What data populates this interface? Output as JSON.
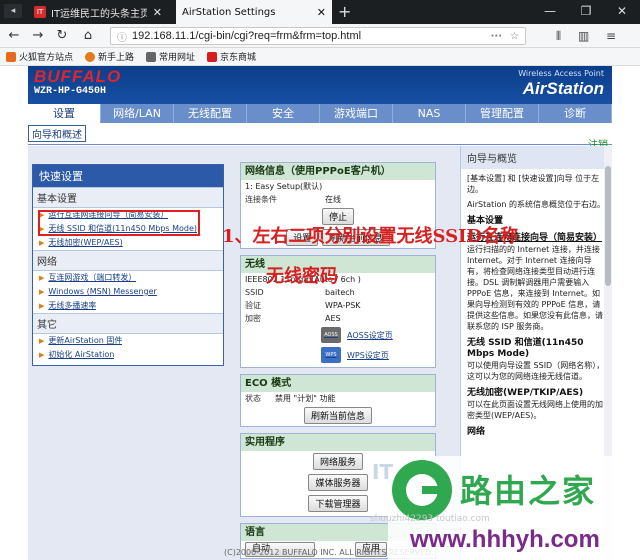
{
  "browser": {
    "tabs": [
      {
        "label": "IT运维民工的头条主页 - 今日头",
        "favicon_text": "IT"
      },
      {
        "label": "AirStation Settings"
      }
    ],
    "url": "192.168.11.1/cgi-bin/cgi?req=frm&frm=top.html",
    "bookmarks": [
      "火狐官方站点",
      "新手上路",
      "常用网址",
      "京东商城"
    ]
  },
  "router": {
    "brand": "BUFFALO",
    "model": "WZR-HP-G450H",
    "product_line": "Wireless Access Point",
    "product_name": "AirStation",
    "menu": [
      "设置",
      "网络/LAN",
      "无线配置",
      "安全",
      "游戏端口",
      "NAS",
      "管理配置",
      "诊断"
    ],
    "active_menu": 0,
    "subnav": "向导和概述",
    "help_link": "注销"
  },
  "quick": {
    "title": "快速设置",
    "sections": [
      {
        "name": "基本设置",
        "items": [
          "运行互连网连接向导（简易安装）",
          "无线 SSID 和信道(11n450 Mbps Mode)",
          "无线加密(WEP/AES)"
        ]
      },
      {
        "name": "网络",
        "items": [
          "互连网游戏（端口转发）",
          "Windows (MSN) Messenger",
          "无线多播速率"
        ]
      },
      {
        "name": "其它",
        "items": [
          "更新AirStation 固件",
          "初始化 AirStation"
        ]
      }
    ]
  },
  "status": {
    "net": {
      "title": "网络信息（使用PPPoE客户机）",
      "mode": "1: Easy  Setup(默认)",
      "conn_k": "连接条件",
      "conn_v": "在线",
      "stop_btn": "停止",
      "btn2": "设置",
      "btn3": "刷新当前信息"
    },
    "wireless": {
      "title": "无线",
      "row1": "IEEE802.11n/g/b(Auto / 6ch )",
      "ssid_k": "SSID",
      "ssid_v": "baitech",
      "auth_k": "验证",
      "auth_v": "WPA-PSK",
      "enc_k": "加密",
      "enc_v": "AES",
      "aoss": "AOSS设定页",
      "wps": "WPS设定页",
      "aoss_icon": "AOSS",
      "wps_icon": "WPS"
    },
    "eco": {
      "title": "ECO 模式",
      "state_k": "状态",
      "state_v": "禁用 \"计划\" 功能",
      "refresh": "刷新当前信息"
    },
    "apps": {
      "title": "实用程序",
      "buttons": [
        "网络服务",
        "媒体服务器",
        "下载管理器"
      ]
    },
    "lang": {
      "title": "语言",
      "value": "自动",
      "apply": "应用"
    }
  },
  "help": {
    "title": "向导与概览",
    "p1": "[基本设置] 和 [快速设置]向导 位于左边。",
    "p2": "AirStation 的系统信息概览位于右边。",
    "basic": "基本设置",
    "s1": "运行互连网连接向导（简易安装）",
    "s1t": "运行扫描的的 Internet 连接，并连接 Internet。对于 Internet 连接向导有，将检查网络连接类型目动进行连接。DSL 调制解调器用户需要输入 PPPoE 信息，来连接到 Internet。如果向导检测到有效的 PPPoE 信息，请提供这些信息。如果您没有此信息，请联系您的 ISP 服务商。",
    "s2": "无线 SSID 和信道(11n450 Mbps Mode)",
    "s2t": "可以使用向导设置 SSID（网络名称），这可以为您的网络连接无线信道。",
    "s3": "无线加密(WEP/TKIP/AES)",
    "s3t": "可以在此页面设置无线网络上使用的加密类型(WEP/AES)。",
    "net": "网络"
  },
  "footer": "(C)2000-2012 BUFFALO INC. ALL RIGHTS RESERVED.",
  "annotations": {
    "line1": "1、左右二项分别设置无线SSID名称",
    "line2": "无线密码"
  },
  "watermark": {
    "brand_cn": "路由之家",
    "url": "www.hhhyh.com",
    "faint": "shouzhi42293 toutiao.com",
    "it": "IT"
  },
  "colors": {
    "router_header": "#0c3e8a",
    "nav": "#6a8ec9",
    "annotation": "#d82020",
    "watermark_green": "#2fa84f"
  }
}
